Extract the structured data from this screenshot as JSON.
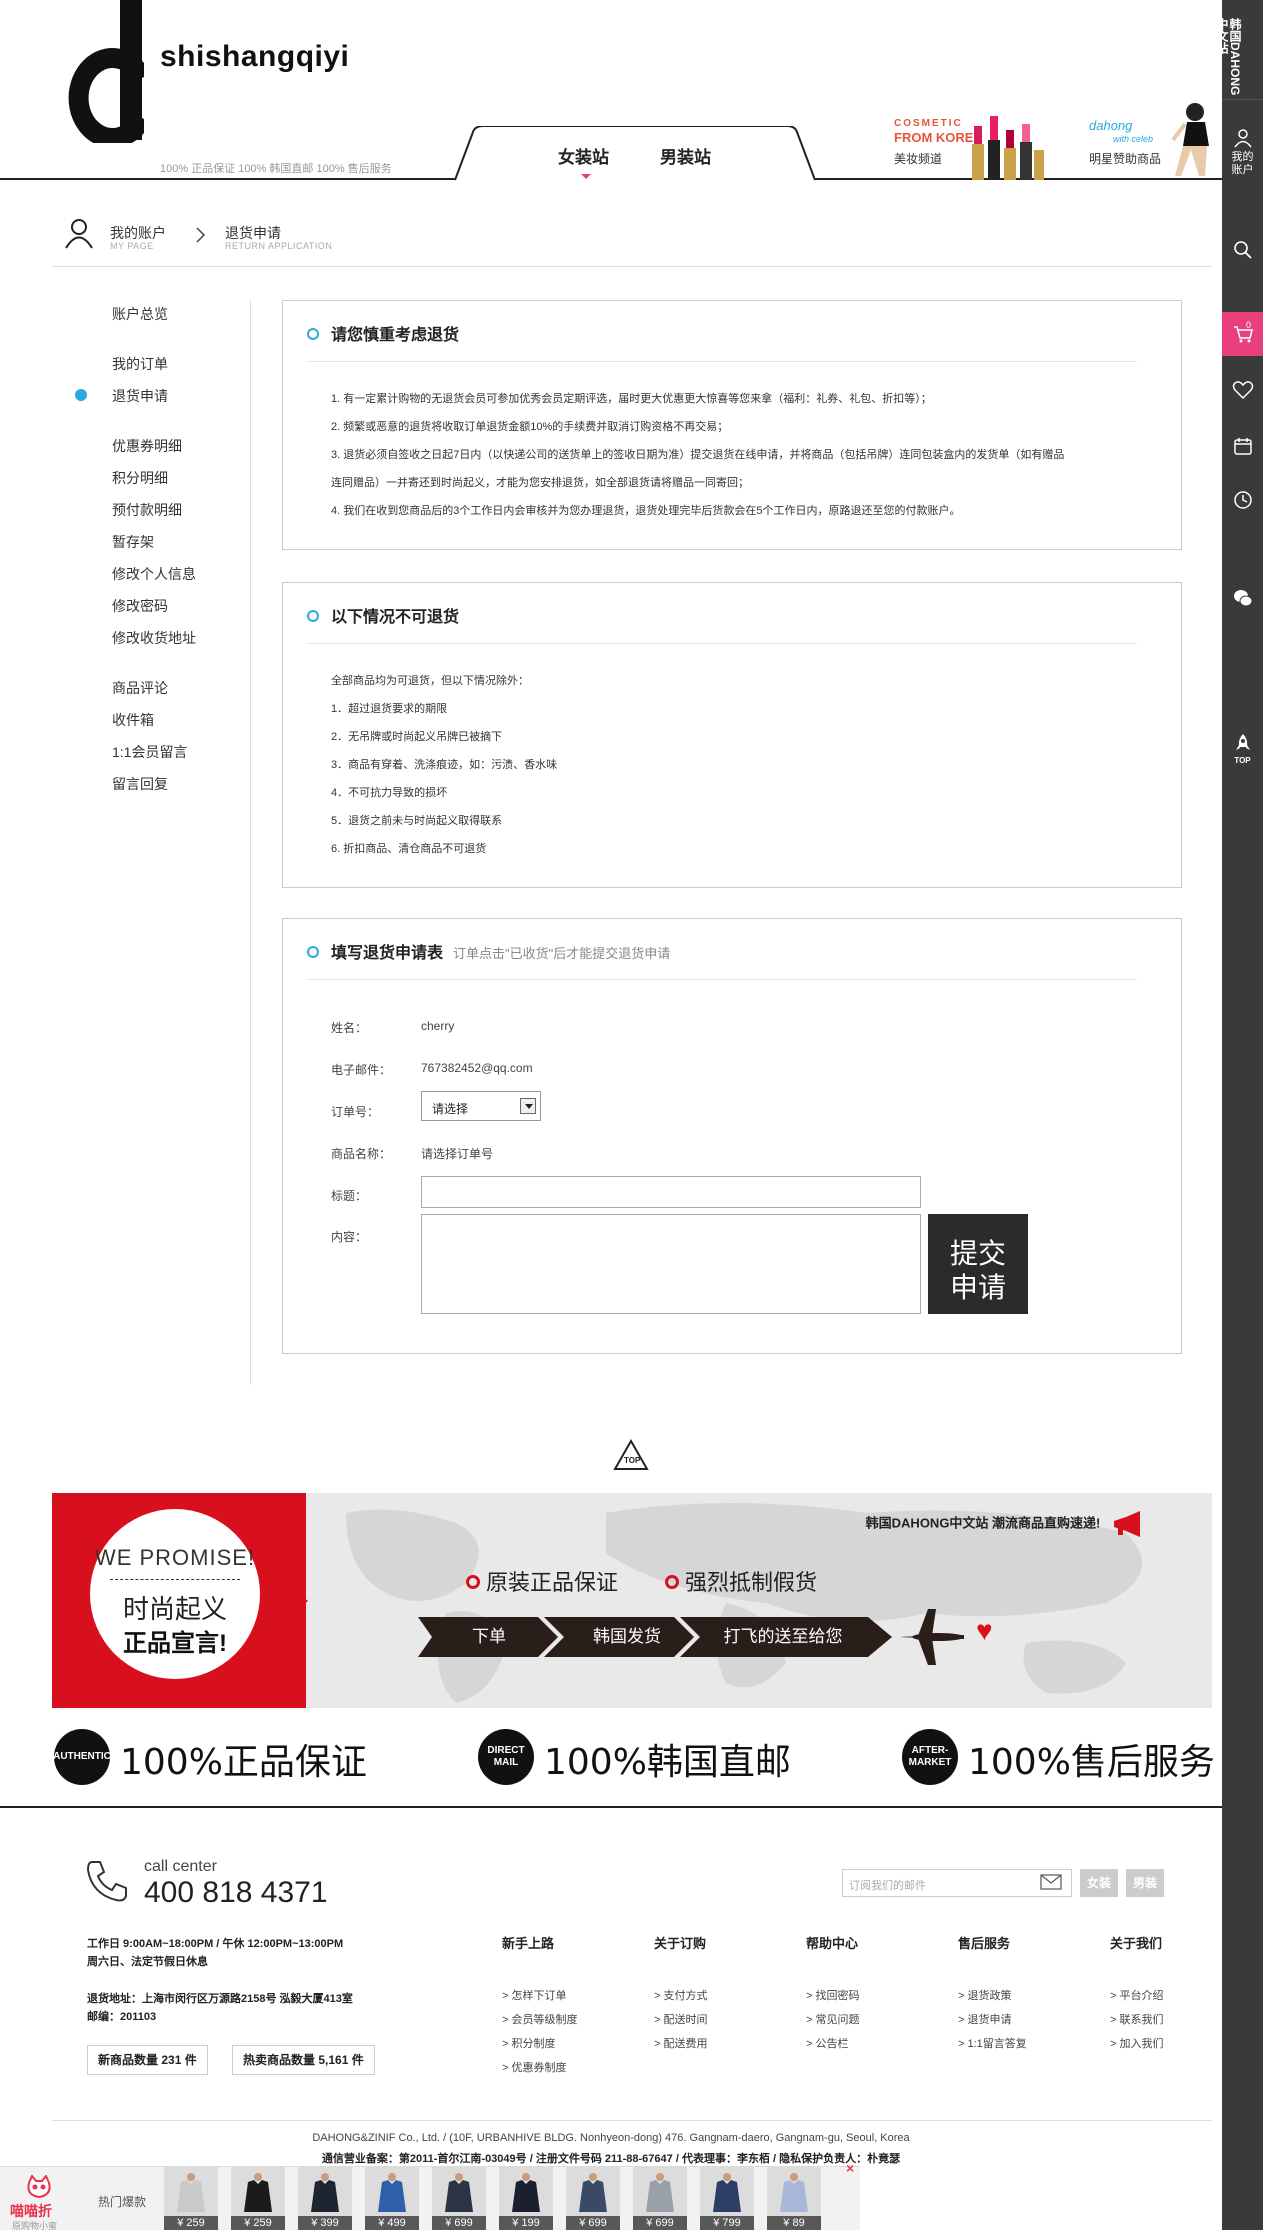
{
  "header": {
    "brand": "shishangqiyi",
    "guarantee": "100% 正品保证  100% 韩国直邮  100% 售后服务",
    "tabs": [
      {
        "label": "女装站"
      },
      {
        "label": "男装站"
      }
    ],
    "promo_beauty": {
      "line1": "COSMETIC",
      "line2": "FROM KOREA",
      "caption": "美妆频道"
    },
    "promo_star": {
      "line1": "dahong",
      "line2": "with celeb",
      "caption": "明星赞助商品"
    }
  },
  "right_bar": {
    "top_label": "韩国DAHONG中文站",
    "account_label": "我的账户",
    "cart_count": "0",
    "top_label_btn": "TOP",
    "icons": [
      "user-icon",
      "search-icon",
      "cart-icon",
      "heart-icon",
      "calendar-icon",
      "clock-icon",
      "wechat-icon",
      "rocket-icon"
    ]
  },
  "breadcrumb": {
    "item1": "我的账户",
    "item1_en": "MY PAGE",
    "item2": "退货申请",
    "item2_en": "RETURN APPLICATION"
  },
  "menu": {
    "items": [
      {
        "label": "账户总览"
      },
      {
        "label": "我的订单"
      },
      {
        "label": "退货申请"
      },
      {
        "label": "优惠券明细"
      },
      {
        "label": "积分明细"
      },
      {
        "label": "预付款明细"
      },
      {
        "label": "暂存架"
      },
      {
        "label": "修改个人信息"
      },
      {
        "label": "修改密码"
      },
      {
        "label": "修改收货地址"
      },
      {
        "label": "商品评论"
      },
      {
        "label": "收件箱"
      },
      {
        "label": "1:1会员留言"
      },
      {
        "label": "留言回复"
      }
    ],
    "active_index": 2
  },
  "notice": {
    "title": "请您慎重考虑退货",
    "lines": [
      "1. 有一定累计购物的无退货会员可参加优秀会员定期评选，届时更大优惠更大惊喜等您来拿（福利：礼券、礼包、折扣等）；",
      "2. 频繁或恶意的退货将收取订单退货金额10%的手续费并取消订购资格不再交易；",
      "3. 退货必须自签收之日起7日内（以快递公司的送货单上的签收日期为准）提交退货在线申请，并将商品（包括吊牌）连同包装盒内的发货单（如有赠品",
      "连同赠品）一并寄还到时尚起义，才能为您安排退货，如全部退货请将赠品一同寄回；",
      "4. 我们在收到您商品后的3个工作日内会审核并为您办理退货，退货处理完毕后货款会在5个工作日内，原路退还至您的付款账户。"
    ]
  },
  "no_return": {
    "title": "以下情况不可退货",
    "lines": [
      "全部商品均为可退货，但以下情况除外：",
      "1．超过退货要求的期限",
      "2．无吊牌或时尚起义吊牌已被摘下",
      "3．商品有穿着、洗涤痕迹，如：污渍、香水味",
      "4．不可抗力导致的损坏",
      "5．退货之前未与时尚起义取得联系",
      "6. 折扣商品、清仓商品不可退货"
    ]
  },
  "form": {
    "title": "填写退货申请表",
    "subtitle": "订单点击\"已收货\"后才能提交退货申请",
    "name_label": "姓名：",
    "name_value": "cherry",
    "email_label": "电子邮件：",
    "email_value": "767382452@qq.com",
    "order_label": "订单号：",
    "order_select": "请选择",
    "product_label": "商品名称：",
    "product_value": "请选择订单号",
    "subject_label": "标题：",
    "content_label": "内容：",
    "submit_line1": "提交",
    "submit_line2": "申请"
  },
  "top_button": "TOP",
  "promise": {
    "en": "WE PROMISE!",
    "cn1": "时尚起义",
    "cn2": "正品宣言!",
    "slogan": "韩国DAHONG中文站  潮流商品直购速递!",
    "feat1": "原装正品保证",
    "feat2": "强烈抵制假货",
    "steps": [
      "下单",
      "韩国发货",
      "打飞的送至给您"
    ]
  },
  "guarantees": [
    {
      "badge": "AUTHENTIC",
      "text": "100%正品保证"
    },
    {
      "badge": "DIRECT MAIL",
      "text": "100%韩国直邮"
    },
    {
      "badge": "AFTER-MARKET",
      "text": "100%售后服务"
    }
  ],
  "footer": {
    "cc_label": "call center",
    "cc_number": "400 818 4371",
    "hours1": "工作日 9:00AM~18:00PM / 午休 12:00PM~13:00PM",
    "hours2": "周六日、法定节假日休息",
    "addr1": "退货地址：上海市闵行区万源路2158号 泓毅大厦413室",
    "addr2": "邮编：201103",
    "new_count_label": "新商品数量",
    "new_count": "231 件",
    "hot_count_label": "热卖商品数量",
    "hot_count": "5,161 件",
    "subscribe_placeholder": "订阅我们的邮件",
    "sub_women": "女装",
    "sub_men": "男装",
    "columns": [
      {
        "title": "新手上路",
        "links": [
          "> 怎样下订单",
          "> 会员等级制度",
          "> 积分制度",
          "> 优惠券制度"
        ]
      },
      {
        "title": "关于订购",
        "links": [
          "> 支付方式",
          "> 配送时间",
          "> 配送费用"
        ]
      },
      {
        "title": "帮助中心",
        "links": [
          "> 找回密码",
          "> 常见问题",
          "> 公告栏"
        ]
      },
      {
        "title": "售后服务",
        "links": [
          "> 退货政策",
          "> 退货申请",
          "> 1:1留言答复"
        ]
      },
      {
        "title": "关于我们",
        "links": [
          "> 平台介绍",
          "> 联系我们",
          "> 加入我们"
        ]
      }
    ],
    "company": "DAHONG&ZINIF Co., Ltd. / (10F, URBANHIVE BLDG. Nonhyeon-dong) 476. Gangnam-daero, Gangnam-gu, Seoul, Korea",
    "icp": "通信营业备案：第2011-首尔江南-03049号 / 注册文件号码 211-88-67647 / 代表理事：李东栢 / 隐私保护负责人：朴竟瑟"
  },
  "bottom_bar": {
    "logo": "喵喵折",
    "logo_sub": "原购物小蜜",
    "hot_label": "热门爆款",
    "close": "×",
    "products": [
      {
        "price": "¥ 259",
        "color": "#c9c9c9"
      },
      {
        "price": "¥ 259",
        "color": "#1b1b1b"
      },
      {
        "price": "¥ 399",
        "color": "#1e2430"
      },
      {
        "price": "¥ 499",
        "color": "#2f5fa8"
      },
      {
        "price": "¥ 699",
        "color": "#2b3444"
      },
      {
        "price": "¥ 199",
        "color": "#1a2030"
      },
      {
        "price": "¥ 699",
        "color": "#3a4a66"
      },
      {
        "price": "¥ 699",
        "color": "#9aa0aa"
      },
      {
        "price": "¥ 799",
        "color": "#2c3e66"
      },
      {
        "price": "¥ 89",
        "color": "#a9b8d8"
      }
    ]
  },
  "colors": {
    "accent_blue": "#2aa8e0",
    "accent_pink": "#e8407c",
    "promise_red": "#d8101d",
    "dark": "#2b2b2b"
  }
}
